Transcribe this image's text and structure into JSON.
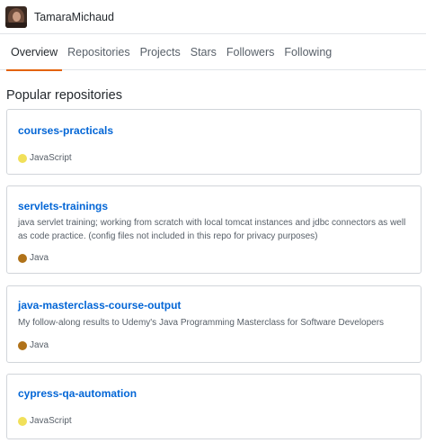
{
  "header": {
    "username": "TamaraMichaud"
  },
  "tabs": [
    {
      "label": "Overview",
      "active": true
    },
    {
      "label": "Repositories",
      "active": false
    },
    {
      "label": "Projects",
      "active": false
    },
    {
      "label": "Stars",
      "active": false
    },
    {
      "label": "Followers",
      "active": false
    },
    {
      "label": "Following",
      "active": false
    }
  ],
  "section_title": "Popular repositories",
  "repos": [
    {
      "name": "courses-practicals",
      "description": "",
      "language": "JavaScript",
      "language_color": "#f1e05a"
    },
    {
      "name": "servlets-trainings",
      "description": "java servlet training; working from scratch with local tomcat instances and jdbc connectors as well as code practice. (config files not included in this repo for privacy purposes)",
      "language": "Java",
      "language_color": "#b07219"
    },
    {
      "name": "java-masterclass-course-output",
      "description": "My follow-along results to Udemy's Java Programming Masterclass for Software Developers",
      "language": "Java",
      "language_color": "#b07219"
    },
    {
      "name": "cypress-qa-automation",
      "description": "",
      "language": "JavaScript",
      "language_color": "#f1e05a"
    }
  ],
  "colors": {
    "accent_underline": "#e36209",
    "link": "#0366d6",
    "border": "#d1d5da"
  }
}
